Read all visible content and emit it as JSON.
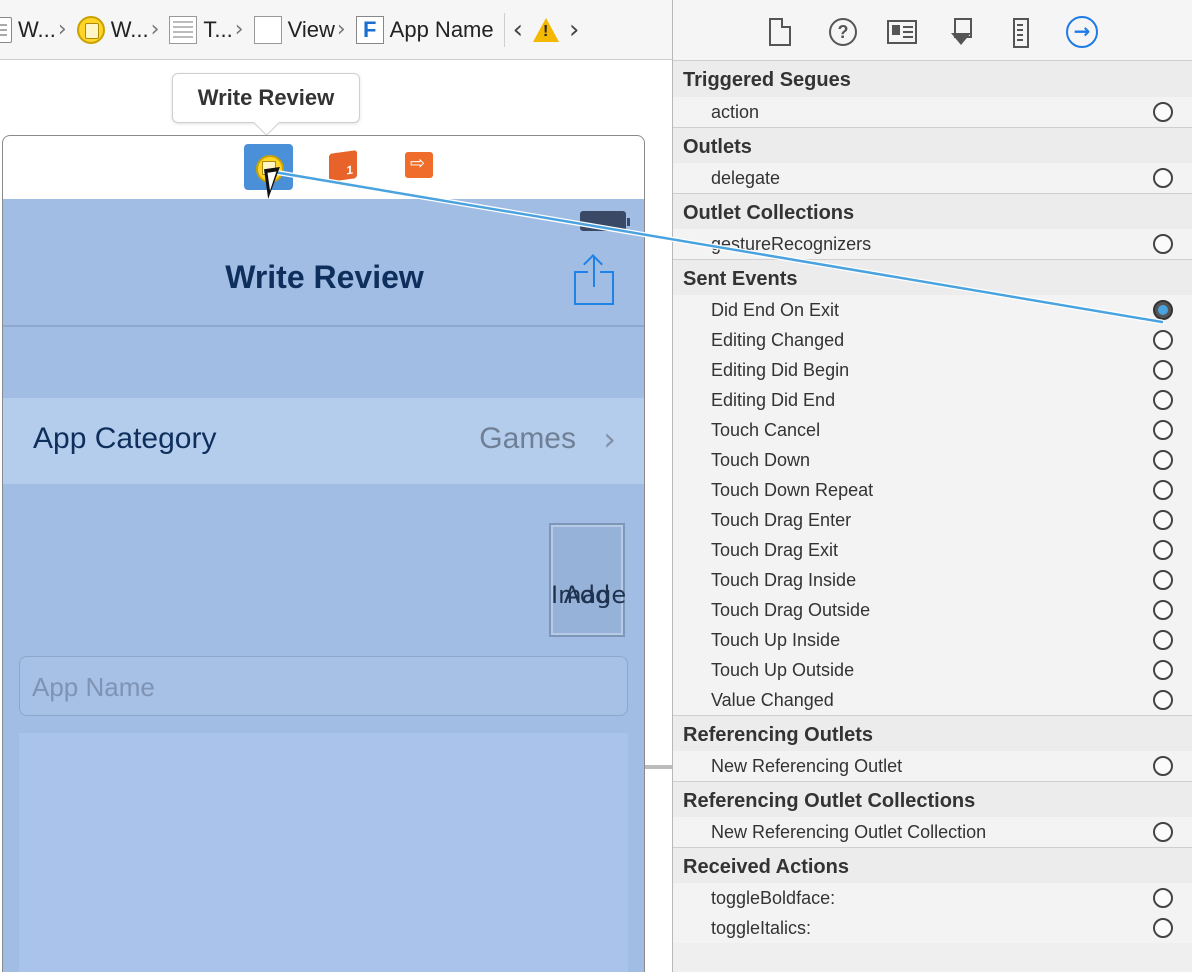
{
  "jumpbar": {
    "crumbs": [
      {
        "label": "W..."
      },
      {
        "label": "W..."
      },
      {
        "label": "T..."
      },
      {
        "label": "View"
      },
      {
        "label": "App Name"
      }
    ],
    "back_arrow": "‹",
    "forward_arrow": "›",
    "warning_mark": "!"
  },
  "canvas": {
    "tooltip": "Write Review",
    "dock_icons": [
      "view-controller-icon",
      "first-responder-icon",
      "exit-icon"
    ],
    "nav_title": "Write Review",
    "category_label": "App Category",
    "category_value": "Games",
    "add_image_line1": "Add",
    "add_image_line2": "Image",
    "app_name_placeholder": "App Name"
  },
  "inspector": {
    "tabs": [
      "file-inspector-icon",
      "quick-help-icon",
      "identity-inspector-icon",
      "attributes-inspector-icon",
      "size-inspector-icon",
      "connections-inspector-icon"
    ],
    "active_tab": "connections-inspector-icon",
    "help_glyph": "?",
    "conn_glyph": "→",
    "sections": [
      {
        "title": "Triggered Segues",
        "items": [
          {
            "label": "action",
            "connected": false
          }
        ]
      },
      {
        "title": "Outlets",
        "items": [
          {
            "label": "delegate",
            "connected": false
          }
        ]
      },
      {
        "title": "Outlet Collections",
        "items": [
          {
            "label": "gestureRecognizers",
            "connected": false
          }
        ]
      },
      {
        "title": "Sent Events",
        "items": [
          {
            "label": "Did End On Exit",
            "connected": true
          },
          {
            "label": "Editing Changed",
            "connected": false
          },
          {
            "label": "Editing Did Begin",
            "connected": false
          },
          {
            "label": "Editing Did End",
            "connected": false
          },
          {
            "label": "Touch Cancel",
            "connected": false
          },
          {
            "label": "Touch Down",
            "connected": false
          },
          {
            "label": "Touch Down Repeat",
            "connected": false
          },
          {
            "label": "Touch Drag Enter",
            "connected": false
          },
          {
            "label": "Touch Drag Exit",
            "connected": false
          },
          {
            "label": "Touch Drag Inside",
            "connected": false
          },
          {
            "label": "Touch Drag Outside",
            "connected": false
          },
          {
            "label": "Touch Up Inside",
            "connected": false
          },
          {
            "label": "Touch Up Outside",
            "connected": false
          },
          {
            "label": "Value Changed",
            "connected": false
          }
        ]
      },
      {
        "title": "Referencing Outlets",
        "items": [
          {
            "label": "New Referencing Outlet",
            "connected": false
          }
        ]
      },
      {
        "title": "Referencing Outlet Collections",
        "items": [
          {
            "label": "New Referencing Outlet Collection",
            "connected": false
          }
        ]
      },
      {
        "title": "Received Actions",
        "items": [
          {
            "label": "toggleBoldface:",
            "connected": false
          },
          {
            "label": "toggleItalics:",
            "connected": false
          }
        ]
      }
    ]
  },
  "colors": {
    "accent": "#1e7ae6",
    "device_bg": "#a2bde4",
    "connection_wire": "#4aa3df"
  }
}
